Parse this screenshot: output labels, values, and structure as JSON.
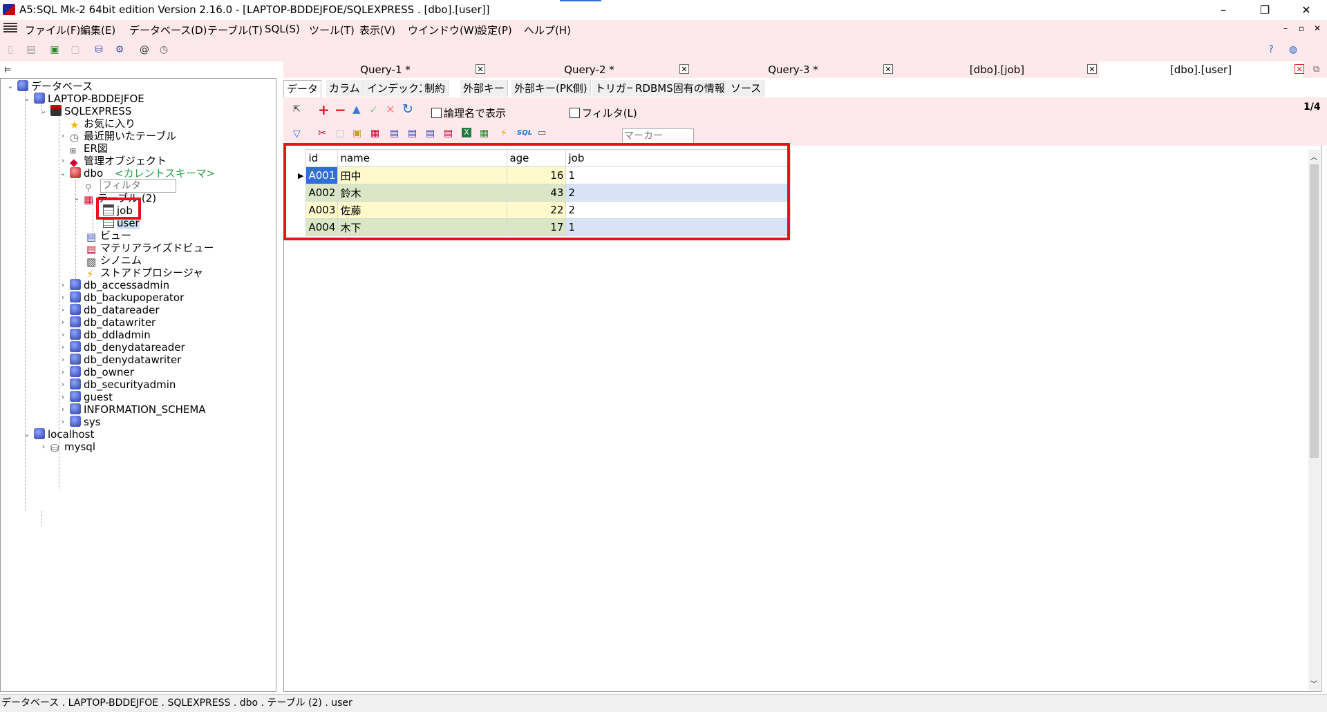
{
  "window": {
    "title": "A5:SQL Mk-2 64bit edition Version 2.16.0 - [LAPTOP-BDDEJFOE/SQLEXPRESS . [dbo].[user]]",
    "minimize": "–",
    "restore": "❐",
    "close": "✕"
  },
  "menu": {
    "items": [
      "ファイル(F)",
      "編集(E)",
      "データベース(D)",
      "テーブル(T)",
      "SQL(S)",
      "ツール(T)",
      "表示(V)",
      "ウインドウ(W)",
      "設定(P)",
      "ヘルプ(H)"
    ],
    "mdi_min": "–",
    "mdi_restore": "▫",
    "mdi_close": "✕"
  },
  "tree": {
    "root": "データベース",
    "server": "LAPTOP-BDDEJFOE",
    "instance": "SQLEXPRESS",
    "favorites": "お気に入り",
    "recent_tables": "最近開いたテーブル",
    "er_diagram": "ER図",
    "admin_objects": "管理オブジェクト",
    "dbo": "dbo",
    "current_schema": "<カレントスキーマ>",
    "filter_placeholder": "フィルタ",
    "tables": "テーブル (2)",
    "table_job": "job",
    "table_user": "user",
    "views": "ビュー",
    "materialized_views": "マテリアライズドビュー",
    "synonyms": "シノニム",
    "stored_procedures": "ストアドプロシージャ",
    "schemas": [
      "db_accessadmin",
      "db_backupoperator",
      "db_datareader",
      "db_datawriter",
      "db_ddladmin",
      "db_denydatareader",
      "db_denydatawriter",
      "db_owner",
      "db_securityadmin",
      "guest",
      "INFORMATION_SCHEMA",
      "sys"
    ],
    "localhost": "localhost",
    "mysql": "mysql"
  },
  "tabs": [
    {
      "label": "Query-1 *"
    },
    {
      "label": "Query-2 *"
    },
    {
      "label": "Query-3 *"
    },
    {
      "label": "[dbo].[job]"
    },
    {
      "label": "[dbo].[user]"
    }
  ],
  "subtabs": [
    "データ",
    "カラム",
    "インデックス",
    "制約",
    "外部キー",
    "外部キー(PK側)",
    "トリガー",
    "RDBMS固有の情報",
    "ソース"
  ],
  "grid_toolbar": {
    "logical_name_label": "論理名で表示",
    "filter_label": "フィルタ(L)",
    "record_position": "1/4",
    "marker_placeholder": "マーカー"
  },
  "grid": {
    "columns": [
      "id",
      "name",
      "age",
      "job"
    ],
    "rows": [
      {
        "id": "A001",
        "name": "田中",
        "age": "16",
        "job": "1"
      },
      {
        "id": "A002",
        "name": "鈴木",
        "age": "43",
        "job": "2"
      },
      {
        "id": "A003",
        "name": "佐藤",
        "age": "22",
        "job": "2"
      },
      {
        "id": "A004",
        "name": "木下",
        "age": "17",
        "job": "1"
      }
    ]
  },
  "status": {
    "path": "データベース . LAPTOP-BDDEJFOE . SQLEXPRESS . dbo . テーブル (2) . user"
  },
  "colors": {
    "chrome_pink": "#fde9ec",
    "highlight_red": "#e3141b",
    "selection_blue": "#2f6fd6",
    "row_yellow": "#fffacc",
    "row_green": "#d9e7c6",
    "row_blue": "#d9e3f8"
  }
}
